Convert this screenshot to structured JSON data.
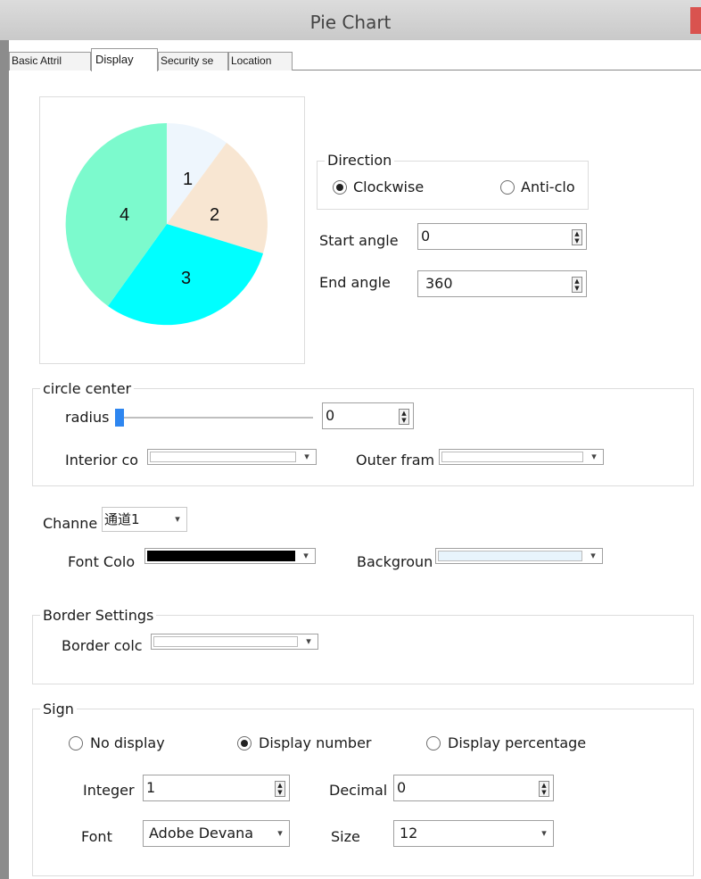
{
  "window": {
    "title": "Pie Chart"
  },
  "tabs": [
    "Basic Attril",
    "Display",
    "Security se",
    "Location"
  ],
  "preview": {
    "slices": [
      "1",
      "2",
      "3",
      "4"
    ],
    "colors": [
      "#eef6fd",
      "#f8e6d2",
      "#00ffff",
      "#7cfacd"
    ]
  },
  "direction": {
    "title": "Direction",
    "options": [
      "Clockwise",
      "Anti-clo"
    ],
    "selected": "Clockwise"
  },
  "start_angle": {
    "label": "Start angle",
    "value": "0"
  },
  "end_angle": {
    "label": "End angle",
    "value": "360"
  },
  "circle_center": {
    "title": "circle center",
    "radius_label": "radius",
    "radius_value": "0",
    "interior_label": "Interior co",
    "outer_label": "Outer fram"
  },
  "channel": {
    "label": "Channe",
    "value": "通道1",
    "font_color_label": "Font Colo",
    "font_color": "#000000",
    "background_label": "Backgroun",
    "background_color": "#e8f4fc"
  },
  "border": {
    "title": "Border Settings",
    "color_label": "Border colc"
  },
  "sign": {
    "title": "Sign",
    "options": [
      "No display",
      "Display number",
      "Display percentage"
    ],
    "selected": "Display number",
    "integer_label": "Integer",
    "integer_value": "1",
    "decimal_label": "Decimal",
    "decimal_value": "0",
    "font_label": "Font",
    "font_value": "Adobe Devana",
    "size_label": "Size",
    "size_value": "12"
  }
}
